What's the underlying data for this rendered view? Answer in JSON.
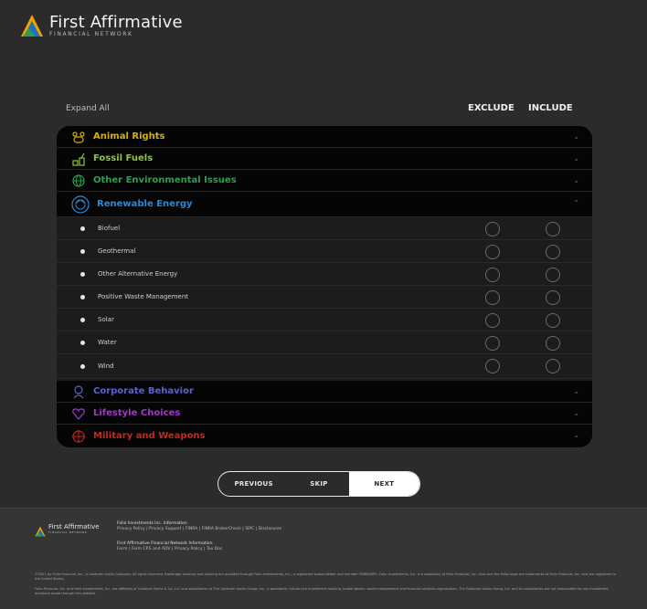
{
  "brand": {
    "name": "First Affirmative",
    "tagline": "FINANCIAL NETWORK",
    "colors": {
      "orange": "#f5a000",
      "blue": "#1e73b8",
      "green": "#2e9e52"
    }
  },
  "controls": {
    "expand_all": "Expand All",
    "exclude_label": "EXCLUDE",
    "include_label": "INCLUDE"
  },
  "categories": [
    {
      "label": "Animal Rights",
      "color": "#d7b400",
      "icon": "paw-icon",
      "expanded": false
    },
    {
      "label": "Fossil Fuels",
      "color": "#8ec63f",
      "icon": "oil-derrick-icon",
      "expanded": false
    },
    {
      "label": "Other Environmental Issues",
      "color": "#23a34e",
      "icon": "globe-icon",
      "expanded": false
    },
    {
      "label": "Renewable Energy",
      "color": "#2a89d6",
      "icon": "recycle-icon",
      "expanded": true
    },
    {
      "label": "Corporate Behavior",
      "color": "#5b62c8",
      "icon": "briefcase-icon",
      "expanded": false
    },
    {
      "label": "Lifestyle Choices",
      "color": "#9b3bbf",
      "icon": "heart-icon",
      "expanded": false
    },
    {
      "label": "Military and Weapons",
      "color": "#c8261d",
      "icon": "crosshair-icon",
      "expanded": false
    }
  ],
  "renewable_items": [
    "Biofuel",
    "Geothermal",
    "Other Alternative Energy",
    "Positive Waste Management",
    "Solar",
    "Water",
    "Wind"
  ],
  "nav": {
    "previous": "PREVIOUS",
    "skip": "SKIP",
    "next": "NEXT"
  },
  "footer": {
    "brand_name": "First Affirmative",
    "brand_tagline": "FINANCIAL NETWORK",
    "block1_title": "Folio Investments Inc. Information",
    "block1_links": "Privacy Policy  |  Privacy Support  |  FINRA  |  FINRA BrokerCheck  |  SIPC  |  Disclosures",
    "block2_title": "First Affirmative Financial Network Information",
    "block2_links": "Form  |  Form CRS and ADV  |  Privacy Policy  |  Tax Doc",
    "legal1": "©2021 by Folio Financial, Inc., a Goldman Sachs Company. All rights reserved. Brokerage services and clearing are provided through Folio Investments, Inc., a registered broker-dealer and member FINRA/SIPC. Folio Investments, Inc. is a subsidiary of Folio Financial, Inc. Folio and the Folio logos are trademarks of Folio Financial, Inc. and are registered in the United States.",
    "legal2": "Folio Financial, Inc. and Folio Investments, Inc. are affiliates of Goldman Sachs & Co. LLC and subsidiaries of The Goldman Sachs Group, Inc., a worldwide, full-service investment banking, broker-dealer, asset management and financial services organization. The Goldman Sachs Group, Inc. and its subsidiaries are not responsible for any investment decisions made through this website."
  }
}
